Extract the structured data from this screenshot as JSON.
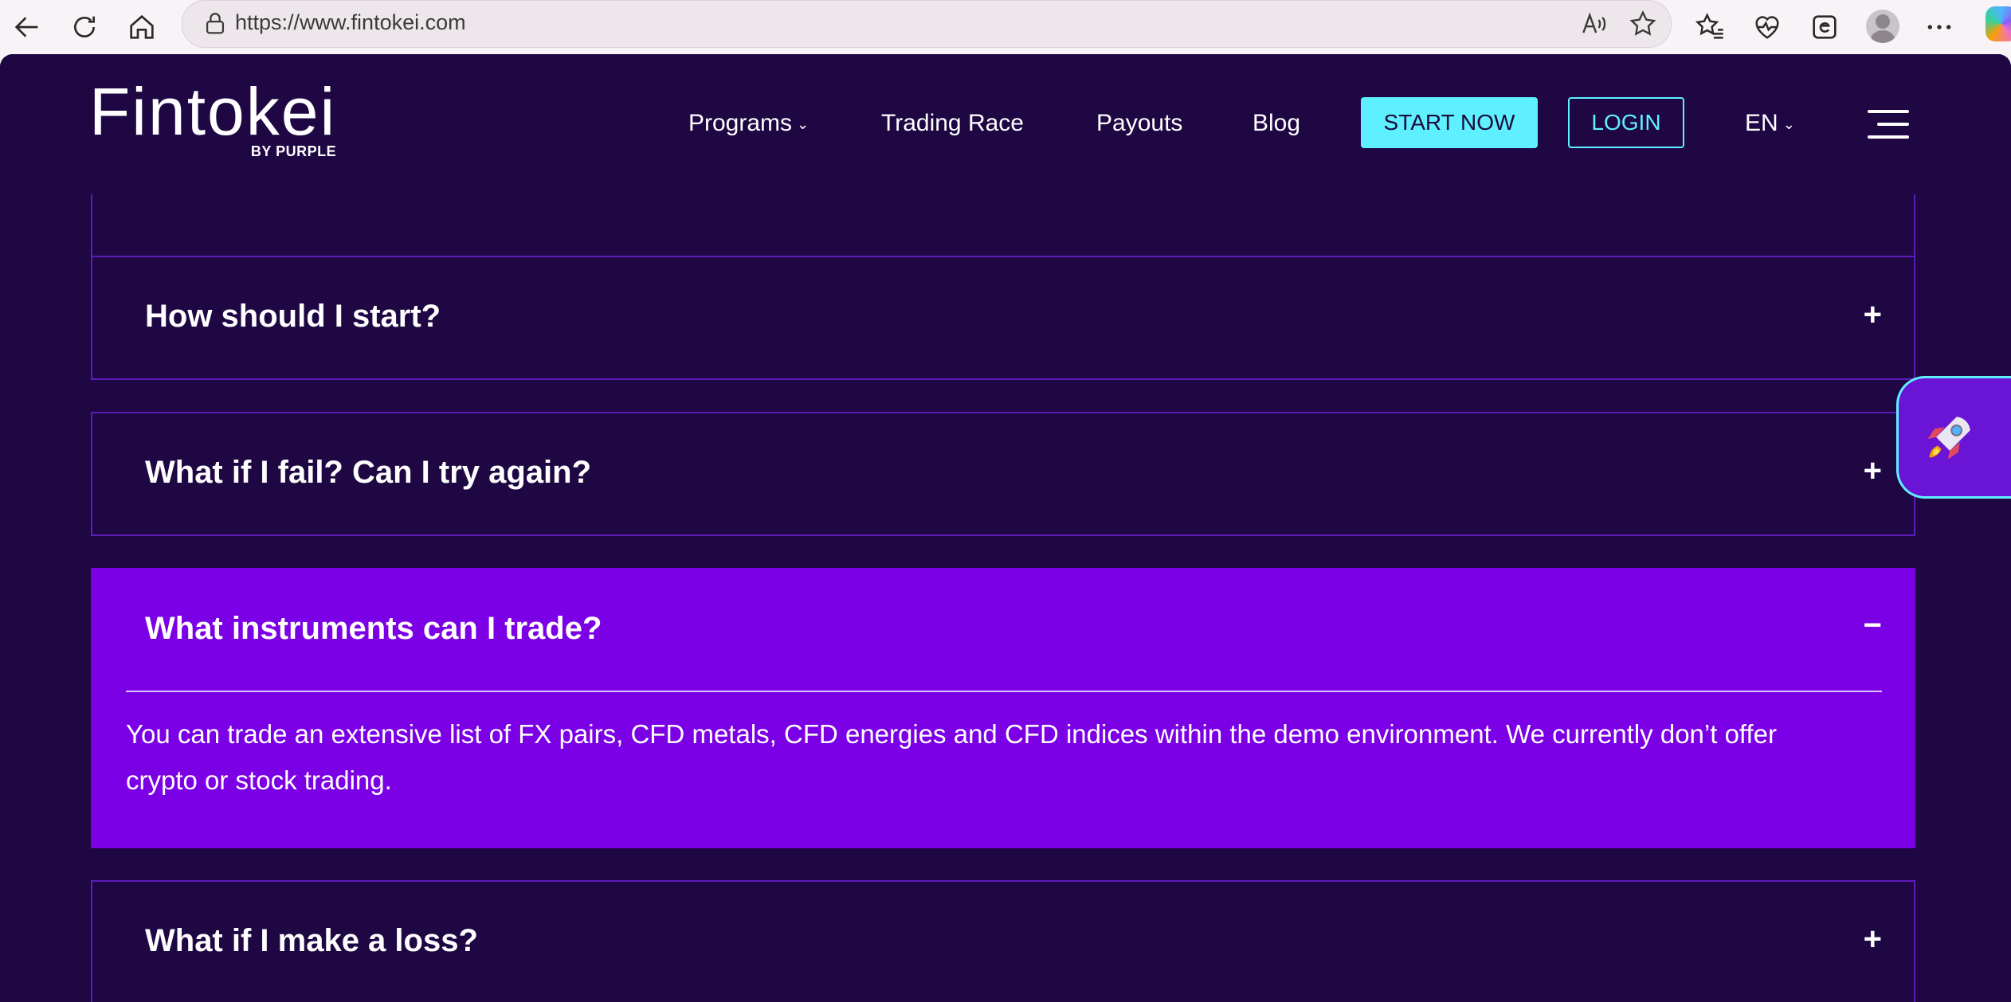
{
  "browser": {
    "url": "https://www.fintokei.com"
  },
  "header": {
    "logo_text": "Fintokei",
    "logo_sub": "BY PURPLE",
    "nav": {
      "programs": "Programs",
      "trading_race": "Trading Race",
      "payouts": "Payouts",
      "blog": "Blog"
    },
    "start_now": "START NOW",
    "login": "LOGIN",
    "language": "EN"
  },
  "faq": {
    "items": [
      {
        "question": "How should I start?",
        "sign": "+"
      },
      {
        "question": "What if I fail? Can I try again?",
        "sign": "+"
      },
      {
        "question": "What instruments can I trade?",
        "sign": "−",
        "answer": "You can trade an extensive list of FX pairs, CFD metals, CFD energies and CFD indices within the demo environment. We currently don’t offer crypto or stock trading."
      },
      {
        "question": "What if I make a loss?",
        "sign": "+"
      }
    ]
  },
  "icons": {
    "back": "back-arrow-icon",
    "refresh": "refresh-icon",
    "home": "home-icon",
    "lock": "lock-icon",
    "read_aloud": "read-aloud-icon",
    "favorite": "star-icon",
    "favorites": "favorites-icon",
    "health": "heartbeat-icon",
    "extensions": "edge-icon",
    "profile": "profile-icon",
    "more": "more-icon",
    "copilot": "copilot-icon",
    "rocket": "rocket-icon",
    "menu": "hamburger-menu-icon"
  },
  "colors": {
    "background": "#1f0744",
    "accent_open": "#7b00e6",
    "cyan": "#5ff0ff",
    "border": "#5d1bbb"
  }
}
